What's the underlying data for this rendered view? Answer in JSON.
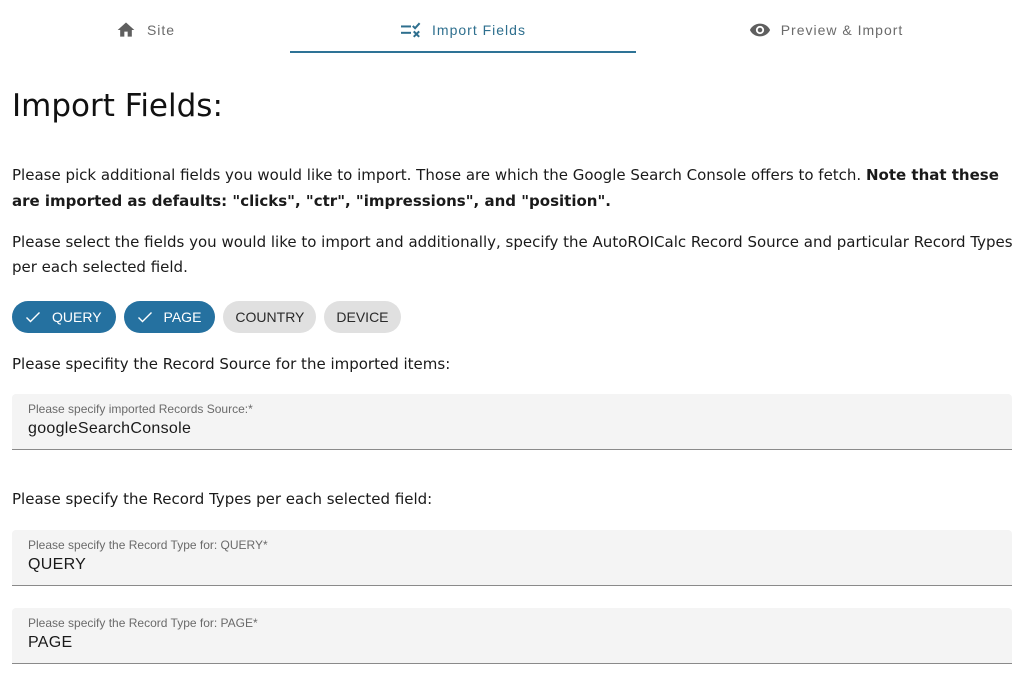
{
  "tabs": [
    {
      "label": "Site",
      "icon": "home-icon",
      "active": false
    },
    {
      "label": "Import Fields",
      "icon": "checklist-icon",
      "active": true
    },
    {
      "label": "Preview & Import",
      "icon": "eye-icon",
      "active": false
    }
  ],
  "colors": {
    "accent": "#2e7396",
    "chip_selected": "#2571a0",
    "chip_unselected": "#e0e0e0",
    "field_bg": "#f4f4f4"
  },
  "page": {
    "title": "Import Fields:",
    "intro_text": "Please pick additional fields you would like to import. Those are which the Google Search Console offers to fetch. ",
    "intro_bold": "Note that these are imported as defaults: \"clicks\", \"ctr\", \"impressions\", and \"position\".",
    "instructions": "Please select the fields you would like to import and additionally, specify the AutoROICalc Record Source and particular Record Types per each selected field.",
    "record_source_prompt": "Please specifity the Record Source for the imported items:",
    "record_types_prompt": "Please specify the Record Types per each selected field:"
  },
  "chips": [
    {
      "label": "QUERY",
      "selected": true
    },
    {
      "label": "PAGE",
      "selected": true
    },
    {
      "label": "COUNTRY",
      "selected": false
    },
    {
      "label": "DEVICE",
      "selected": false
    }
  ],
  "fields": {
    "records_source": {
      "label": "Please specify imported Records Source:*",
      "value": "googleSearchConsole"
    },
    "record_type_query": {
      "label": "Please specify the Record Type for: QUERY*",
      "value": "QUERY"
    },
    "record_type_page": {
      "label": "Please specify the Record Type for: PAGE*",
      "value": "PAGE"
    }
  }
}
